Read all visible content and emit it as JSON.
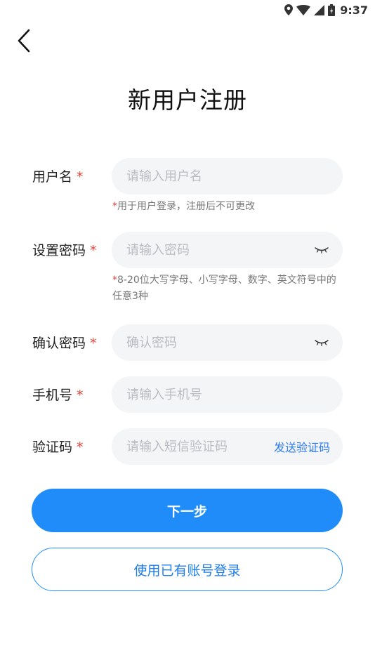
{
  "status_bar": {
    "time": "9:37",
    "icons": [
      "location-icon",
      "wifi-icon",
      "signal-icon",
      "battery-icon"
    ]
  },
  "header": {
    "back_icon": "chevron-left-icon",
    "title": "新用户注册"
  },
  "form": {
    "username": {
      "label": "用户名",
      "required_mark": "*",
      "placeholder": "请输入用户名",
      "value": "",
      "hint_star": "*",
      "hint": "用于用户登录，注册后不可更改"
    },
    "password": {
      "label": "设置密码",
      "required_mark": "*",
      "placeholder": "请输入密码",
      "value": "",
      "toggle_icon": "eye-closed-icon",
      "hint_star": "*",
      "hint": "8-20位大写字母、小写字母、数字、英文符号中的任意3种"
    },
    "confirm_password": {
      "label": "确认密码",
      "required_mark": "*",
      "placeholder": "确认密码",
      "value": "",
      "toggle_icon": "eye-closed-icon"
    },
    "phone": {
      "label": "手机号",
      "required_mark": "*",
      "placeholder": "请输入手机号",
      "value": ""
    },
    "verification_code": {
      "label": "验证码",
      "required_mark": "*",
      "placeholder": "请输入短信验证码",
      "value": "",
      "send_label": "发送验证码"
    }
  },
  "actions": {
    "next_label": "下一步",
    "login_label": "使用已有账号登录"
  },
  "colors": {
    "primary": "#1f8cf9",
    "required": "#e2453c",
    "link": "#2d7df0",
    "input_bg": "#f4f5f7"
  }
}
